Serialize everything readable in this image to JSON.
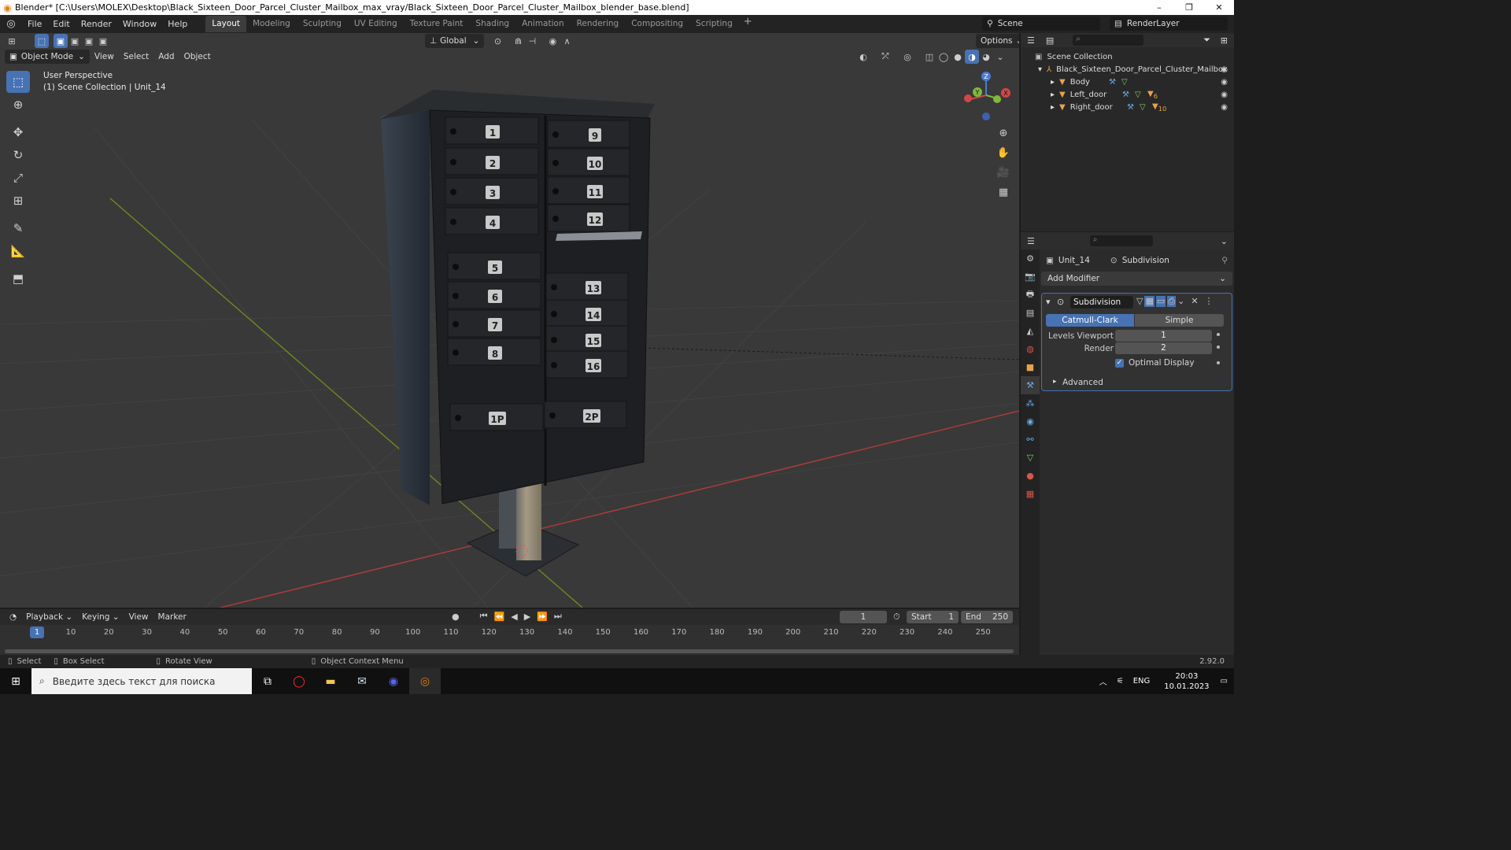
{
  "window": {
    "title": "Blender* [C:\\Users\\MOLEX\\Desktop\\Black_Sixteen_Door_Parcel_Cluster_Mailbox_max_vray/Black_Sixteen_Door_Parcel_Cluster_Mailbox_blender_base.blend]",
    "minimize": "–",
    "maximize": "❐",
    "close": "✕"
  },
  "menu": [
    "File",
    "Edit",
    "Render",
    "Window",
    "Help"
  ],
  "workspaces": [
    {
      "label": "Layout",
      "active": true
    },
    {
      "label": "Modeling"
    },
    {
      "label": "Sculpting"
    },
    {
      "label": "UV Editing"
    },
    {
      "label": "Texture Paint"
    },
    {
      "label": "Shading"
    },
    {
      "label": "Animation"
    },
    {
      "label": "Rendering"
    },
    {
      "label": "Compositing"
    },
    {
      "label": "Scripting"
    }
  ],
  "add_workspace": "+",
  "scene": "Scene",
  "view_layer": "RenderLayer",
  "viewport": {
    "transform_orientation": "Global",
    "options": "Options",
    "mode": "Object Mode",
    "menus": [
      "View",
      "Select",
      "Add",
      "Object"
    ],
    "overlay_line1": "User Perspective",
    "overlay_line2": "(1) Scene Collection | Unit_14",
    "gizmo": {
      "z": "Z",
      "y": "Y",
      "x": "X"
    }
  },
  "mailbox": {
    "left_doors": [
      "1",
      "2",
      "3",
      "4",
      "5",
      "6",
      "7",
      "8"
    ],
    "right_doors": [
      "9",
      "10",
      "11",
      "12",
      "13",
      "14",
      "15",
      "16"
    ],
    "parcel_left": "1P",
    "parcel_right": "2P"
  },
  "timeline": {
    "menus": [
      "Playback",
      "Keying",
      "View",
      "Marker"
    ],
    "current_frame": "1",
    "start_label": "Start",
    "start": "1",
    "end_label": "End",
    "end": "250",
    "ticks": [
      "1",
      "10",
      "20",
      "30",
      "40",
      "50",
      "60",
      "70",
      "80",
      "90",
      "100",
      "110",
      "120",
      "130",
      "140",
      "150",
      "160",
      "170",
      "180",
      "190",
      "200",
      "210",
      "220",
      "230",
      "240",
      "250"
    ]
  },
  "status": {
    "select": "Select",
    "box_select": "Box Select",
    "rotate": "Rotate View",
    "context": "Object Context Menu",
    "version": "2.92.0"
  },
  "outliner": {
    "root": "Scene Collection",
    "collection": "Black_Sixteen_Door_Parcel_Cluster_Mailbox",
    "items": [
      {
        "name": "Body"
      },
      {
        "name": "Left_door",
        "badge": "6"
      },
      {
        "name": "Right_door",
        "badge": "10"
      }
    ]
  },
  "properties": {
    "object": "Unit_14",
    "modifier_crumb": "Subdivision",
    "add_modifier": "Add Modifier",
    "modifier_name": "Subdivision",
    "mode_a": "Catmull-Clark",
    "mode_b": "Simple",
    "levels_viewport_label": "Levels Viewport",
    "levels_viewport": "1",
    "render_label": "Render",
    "render": "2",
    "optimal_display": "Optimal Display",
    "advanced": "Advanced"
  },
  "taskbar": {
    "search_placeholder": "Введите здесь текст для поиска",
    "lang": "ENG",
    "time": "20:03",
    "date": "10.01.2023"
  },
  "colors": {
    "accent": "#4772b3",
    "viewport_bg": "#393939",
    "axis_red": "#b23b3b",
    "axis_green": "#6d8a1f"
  }
}
